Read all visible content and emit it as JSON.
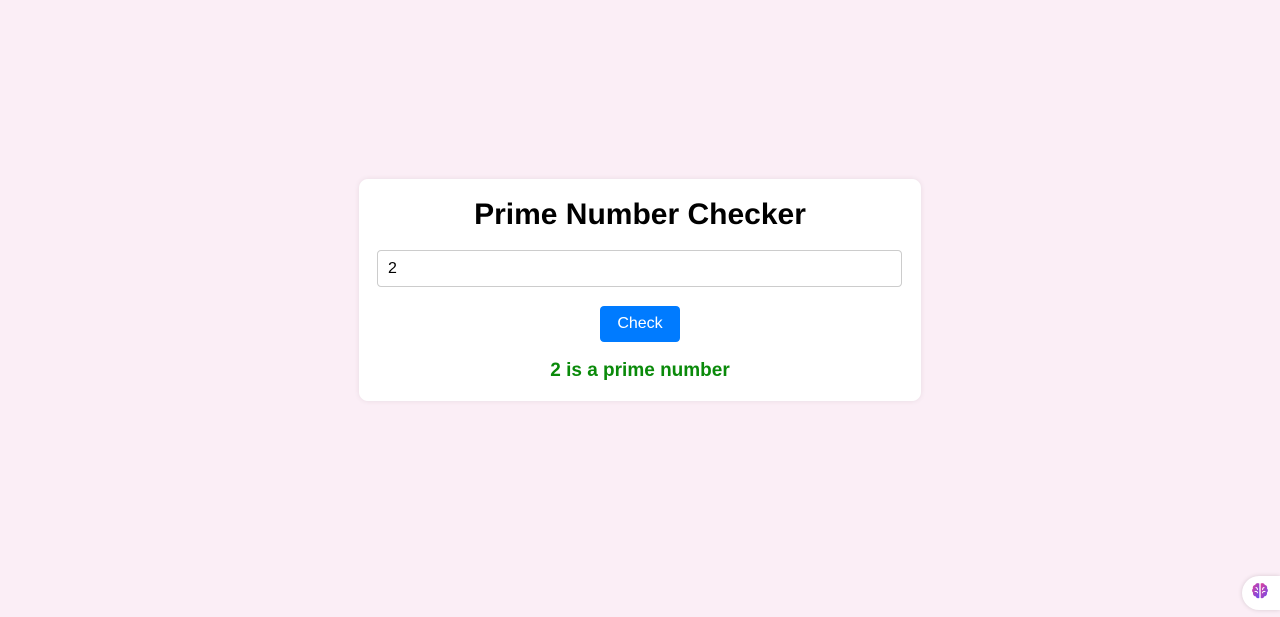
{
  "app": {
    "title": "Prime Number Checker"
  },
  "form": {
    "input_value": "2",
    "check_label": "Check"
  },
  "result": {
    "text": "2 is a prime number",
    "color": "#0a8a0a"
  },
  "colors": {
    "background": "#fbeef6",
    "card": "#ffffff",
    "button": "#007bff"
  },
  "corner_widget": {
    "icon": "brain-icon"
  }
}
